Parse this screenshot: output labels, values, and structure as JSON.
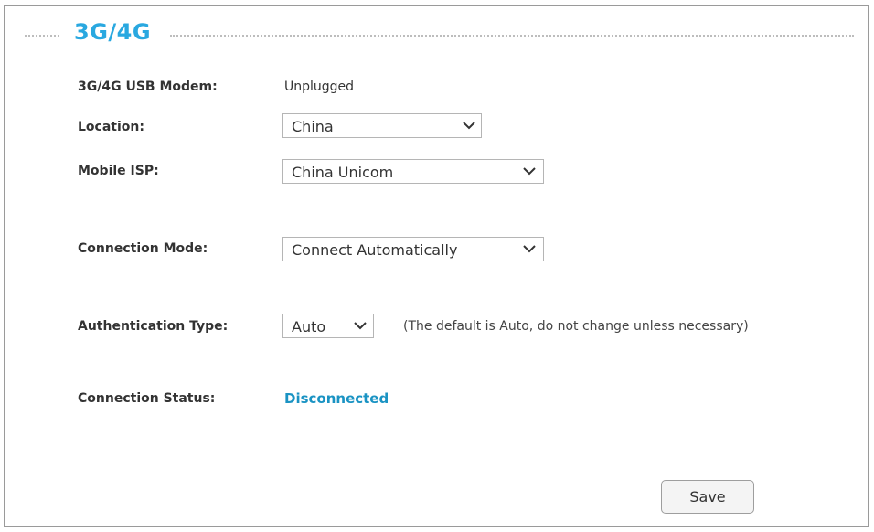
{
  "section": {
    "title": "3G/4G"
  },
  "form": {
    "modem": {
      "label": "3G/4G USB Modem:",
      "value": "Unplugged"
    },
    "location": {
      "label": "Location:",
      "selected": "China"
    },
    "isp": {
      "label": "Mobile ISP:",
      "selected": "China Unicom"
    },
    "connection_mode": {
      "label": "Connection Mode:",
      "selected": "Connect Automatically"
    },
    "auth_type": {
      "label": "Authentication Type:",
      "selected": "Auto",
      "hint": "(The default is Auto, do not change unless necessary)"
    },
    "status": {
      "label": "Connection Status:",
      "value": "Disconnected"
    }
  },
  "actions": {
    "save_label": "Save"
  },
  "colors": {
    "accent": "#29a8e0",
    "status": "#1a93c3"
  },
  "icons": {
    "dropdown": "chevron-down-icon"
  }
}
